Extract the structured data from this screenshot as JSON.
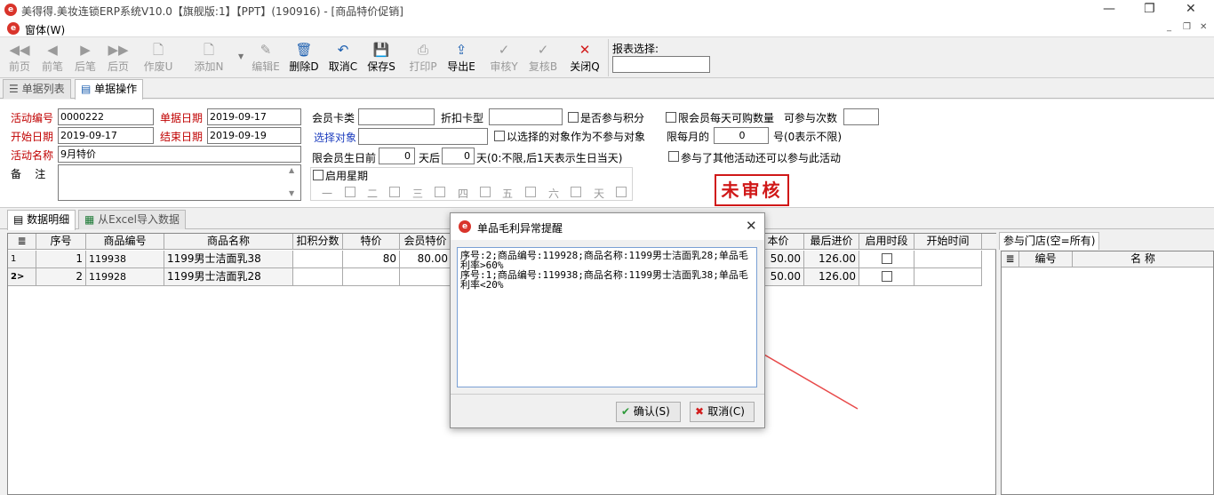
{
  "window": {
    "title": "美得得.美妆连锁ERP系统V10.0【旗舰版:1】【PPT】(190916) - [商品特价促销]",
    "logo": "e"
  },
  "menubar": {
    "menu": "窗体(W)"
  },
  "toolbar": {
    "items": [
      {
        "label": "前页",
        "icon": "◀◀",
        "enabled": false
      },
      {
        "label": "前笔",
        "icon": "◀",
        "enabled": false
      },
      {
        "label": "后笔",
        "icon": "▶",
        "enabled": false
      },
      {
        "label": "后页",
        "icon": "▶▶",
        "enabled": false
      },
      {
        "label": "作废U",
        "icon": "🗋",
        "enabled": false
      },
      {
        "label": "添加N",
        "icon": "🗋",
        "enabled": false
      },
      {
        "label": "编辑E",
        "icon": "✎",
        "enabled": false
      },
      {
        "label": "删除D",
        "icon": "🗑",
        "enabled": true
      },
      {
        "label": "取消C",
        "icon": "↶",
        "enabled": true
      },
      {
        "label": "保存S",
        "icon": "💾",
        "enabled": true
      },
      {
        "label": "打印P",
        "icon": "⎙",
        "enabled": false
      },
      {
        "label": "导出E",
        "icon": "⇪",
        "enabled": true
      },
      {
        "label": "审核Y",
        "icon": "✓",
        "enabled": false
      },
      {
        "label": "复核B",
        "icon": "✓",
        "enabled": false
      },
      {
        "label": "关闭Q",
        "icon": "✕",
        "enabled": true
      }
    ],
    "report_label": "报表选择:",
    "report_value": ""
  },
  "tabs_top": [
    {
      "label": "单据列表",
      "active": false
    },
    {
      "label": "单据操作",
      "active": true
    }
  ],
  "form": {
    "activity_no_label": "活动编号",
    "activity_no": "0000222",
    "doc_date_label": "单据日期",
    "doc_date": "2019-09-17",
    "start_date_label": "开始日期",
    "start_date": "2019-09-17",
    "end_date_label": "结束日期",
    "end_date": "2019-09-19",
    "activity_name_label": "活动名称",
    "activity_name": "9月特价",
    "remark_label": "备    注",
    "remark": "",
    "member_card_label": "会员卡类",
    "member_card": "",
    "discount_card_label": "折扣卡型",
    "discount_card": "",
    "points_label": "是否参与积分",
    "select_target_label": "选择对象",
    "select_target": "",
    "exclude_label": "以选择的对象作为不参与对象",
    "birthday_label": "限会员生日前",
    "birthday_before": "0",
    "birthday_after_label": "天后",
    "birthday_after": "0",
    "birthday_note": "天(0:不限,后1天表示生日当天)",
    "enable_week_label": "启用星期",
    "weekdays": [
      "一",
      "二",
      "三",
      "四",
      "五",
      "六",
      "天"
    ],
    "daily_limit_label": "限会员每天可购数量",
    "times_label": "可参与次数",
    "times": "",
    "monthly_label": "限每月的",
    "monthly_value": "0",
    "monthly_note": "号(0表示不限)",
    "other_activity_label": "参与了其他活动还可以参与此活动",
    "status_stamp": "未审核"
  },
  "tabs_detail": [
    {
      "label": "数据明细",
      "active": true
    },
    {
      "label": "从Excel导入数据",
      "active": false
    }
  ],
  "grid": {
    "columns": [
      "序号",
      "商品编号",
      "商品名称",
      "扣积分数",
      "特价",
      "会员特价",
      "本价",
      "最后进价",
      "启用时段",
      "开始时间"
    ],
    "rows": [
      {
        "indicator": "1",
        "seq": "1",
        "code": "119938",
        "name": "1199男士洁面乳38",
        "points": "",
        "special": "80",
        "member_special": "80.00",
        "cost": "50.00",
        "last_price": "126.00"
      },
      {
        "indicator": "2>",
        "seq": "2",
        "code": "119928",
        "name": "1199男士洁面乳28",
        "points": "",
        "special": "",
        "member_special": "",
        "cost": "50.00",
        "last_price": "126.00"
      }
    ]
  },
  "stores": {
    "tab": "参与门店(空=所有)",
    "col_code": "编号",
    "col_name": "名 称"
  },
  "dialog": {
    "title": "单品毛利异常提醒",
    "message": "序号:2;商品编号:119928;商品名称:1199男士洁面乳28;单品毛利率>60%\n序号:1;商品编号:119938;商品名称:1199男士洁面乳38;单品毛利率<20%",
    "ok_label": "确认(S)",
    "cancel_label": "取消(C)"
  }
}
